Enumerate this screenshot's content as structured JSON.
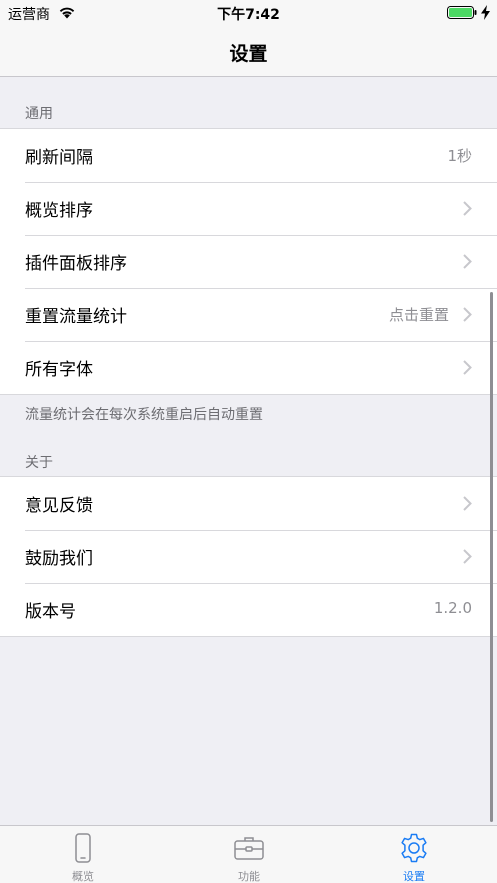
{
  "status_bar": {
    "carrier": "运营商",
    "time": "下午7:42"
  },
  "nav": {
    "title": "设置"
  },
  "sections": {
    "general": {
      "header": "通用",
      "rows": [
        {
          "label": "刷新间隔",
          "value": "1秒"
        },
        {
          "label": "概览排序"
        },
        {
          "label": "插件面板排序"
        },
        {
          "label": "重置流量统计",
          "value": "点击重置"
        },
        {
          "label": "所有字体"
        }
      ],
      "footer": "流量统计会在每次系统重启后自动重置"
    },
    "about": {
      "header": "关于",
      "rows": [
        {
          "label": "意见反馈"
        },
        {
          "label": "鼓励我们"
        },
        {
          "label": "版本号",
          "value": "1.2.0"
        }
      ]
    }
  },
  "tabs": [
    {
      "label": "概览",
      "icon": "phone-icon"
    },
    {
      "label": "功能",
      "icon": "toolbox-icon"
    },
    {
      "label": "设置",
      "icon": "gear-icon"
    }
  ],
  "colors": {
    "accent": "#1a7cf4",
    "battery": "#4cd964",
    "background": "#efeff4"
  }
}
